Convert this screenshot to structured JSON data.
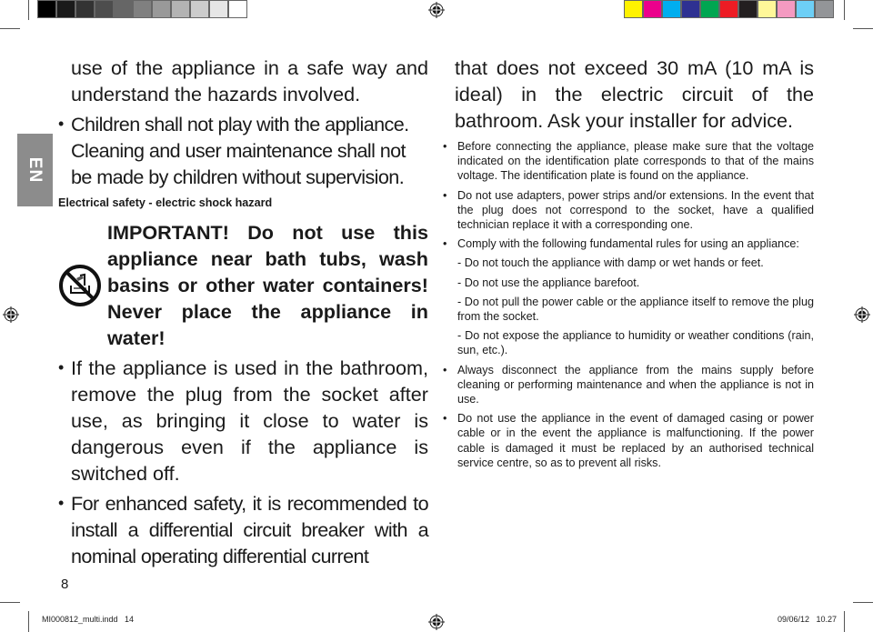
{
  "print_marks": {
    "gray_swatches": [
      "#000000",
      "#1a1a1a",
      "#333333",
      "#4d4d4d",
      "#666666",
      "#808080",
      "#999999",
      "#b3b3b3",
      "#cccccc",
      "#e6e6e6",
      "#ffffff"
    ],
    "color_swatches": [
      "#fff200",
      "#ec008c",
      "#00aeef",
      "#2e3192",
      "#00a651",
      "#ed1c24",
      "#231f20",
      "#fff799",
      "#f49ac1",
      "#6dcff6",
      "#939598"
    ]
  },
  "lang_tab": "EN",
  "left_column": {
    "intro": "use of the appliance in a safe way and understand the hazards involved.",
    "children_bullet": "Children shall not play with the appliance. Cleaning and user maintenance shall not be made by children without supervision.",
    "section_heading": "Electrical safety - electric shock hazard",
    "important_icon": "no-water-bath-icon",
    "important_text": "IMPORTANT! Do not use this appliance near bath tubs, wash basins or other water containers! Never place the appliance in water!",
    "bathroom_bullet": "If the appliance is used in the bathroom, remove the plug from the socket after use, as bringing it close to water is dangerous even if the appliance is switched off.",
    "safety_bullet": "For enhanced safety, it is recommended to install a differential circuit breaker with a nominal operating differential current"
  },
  "right_column": {
    "continuation": "that does not exceed 30 mA (10 mA is ideal) in the electric circuit of the bathroom. Ask your installer for advice.",
    "items": [
      {
        "type": "bullet",
        "text": "Before connecting the appliance, please make sure that the voltage indicated on the identification plate corresponds to that of the mains voltage. The identification plate is found on the appliance."
      },
      {
        "type": "bullet",
        "text": "Do not use adapters, power strips and/or extensions. In the event that the plug does not correspond to the socket, have a qualified technician replace it with a corresponding one."
      },
      {
        "type": "bullet",
        "text": "Comply with the following fundamental rules for using an appliance:"
      },
      {
        "type": "dash",
        "text": "- Do not touch the appliance with damp or wet hands or feet."
      },
      {
        "type": "dash",
        "text": "- Do not use the appliance barefoot."
      },
      {
        "type": "dash",
        "text": "- Do not pull the power cable or the appliance itself to remove the plug from the socket."
      },
      {
        "type": "dash",
        "text": "- Do not expose the appliance to humidity or weather conditions (rain, sun, etc.)."
      },
      {
        "type": "bullet",
        "text": "Always disconnect the appliance from the mains supply before cleaning or performing maintenance and when the appliance is not in use."
      },
      {
        "type": "bullet",
        "text": "Do not use the appliance in the event of damaged casing or power cable or in the event the appliance is malfunctioning. If the power cable is damaged it must be replaced by an authorised technical service centre, so as to prevent all risks."
      }
    ]
  },
  "footer": {
    "page_number": "8",
    "file_slug": "MI000812_multi.indd   14",
    "date_slug": "09/06/12   10.27"
  }
}
